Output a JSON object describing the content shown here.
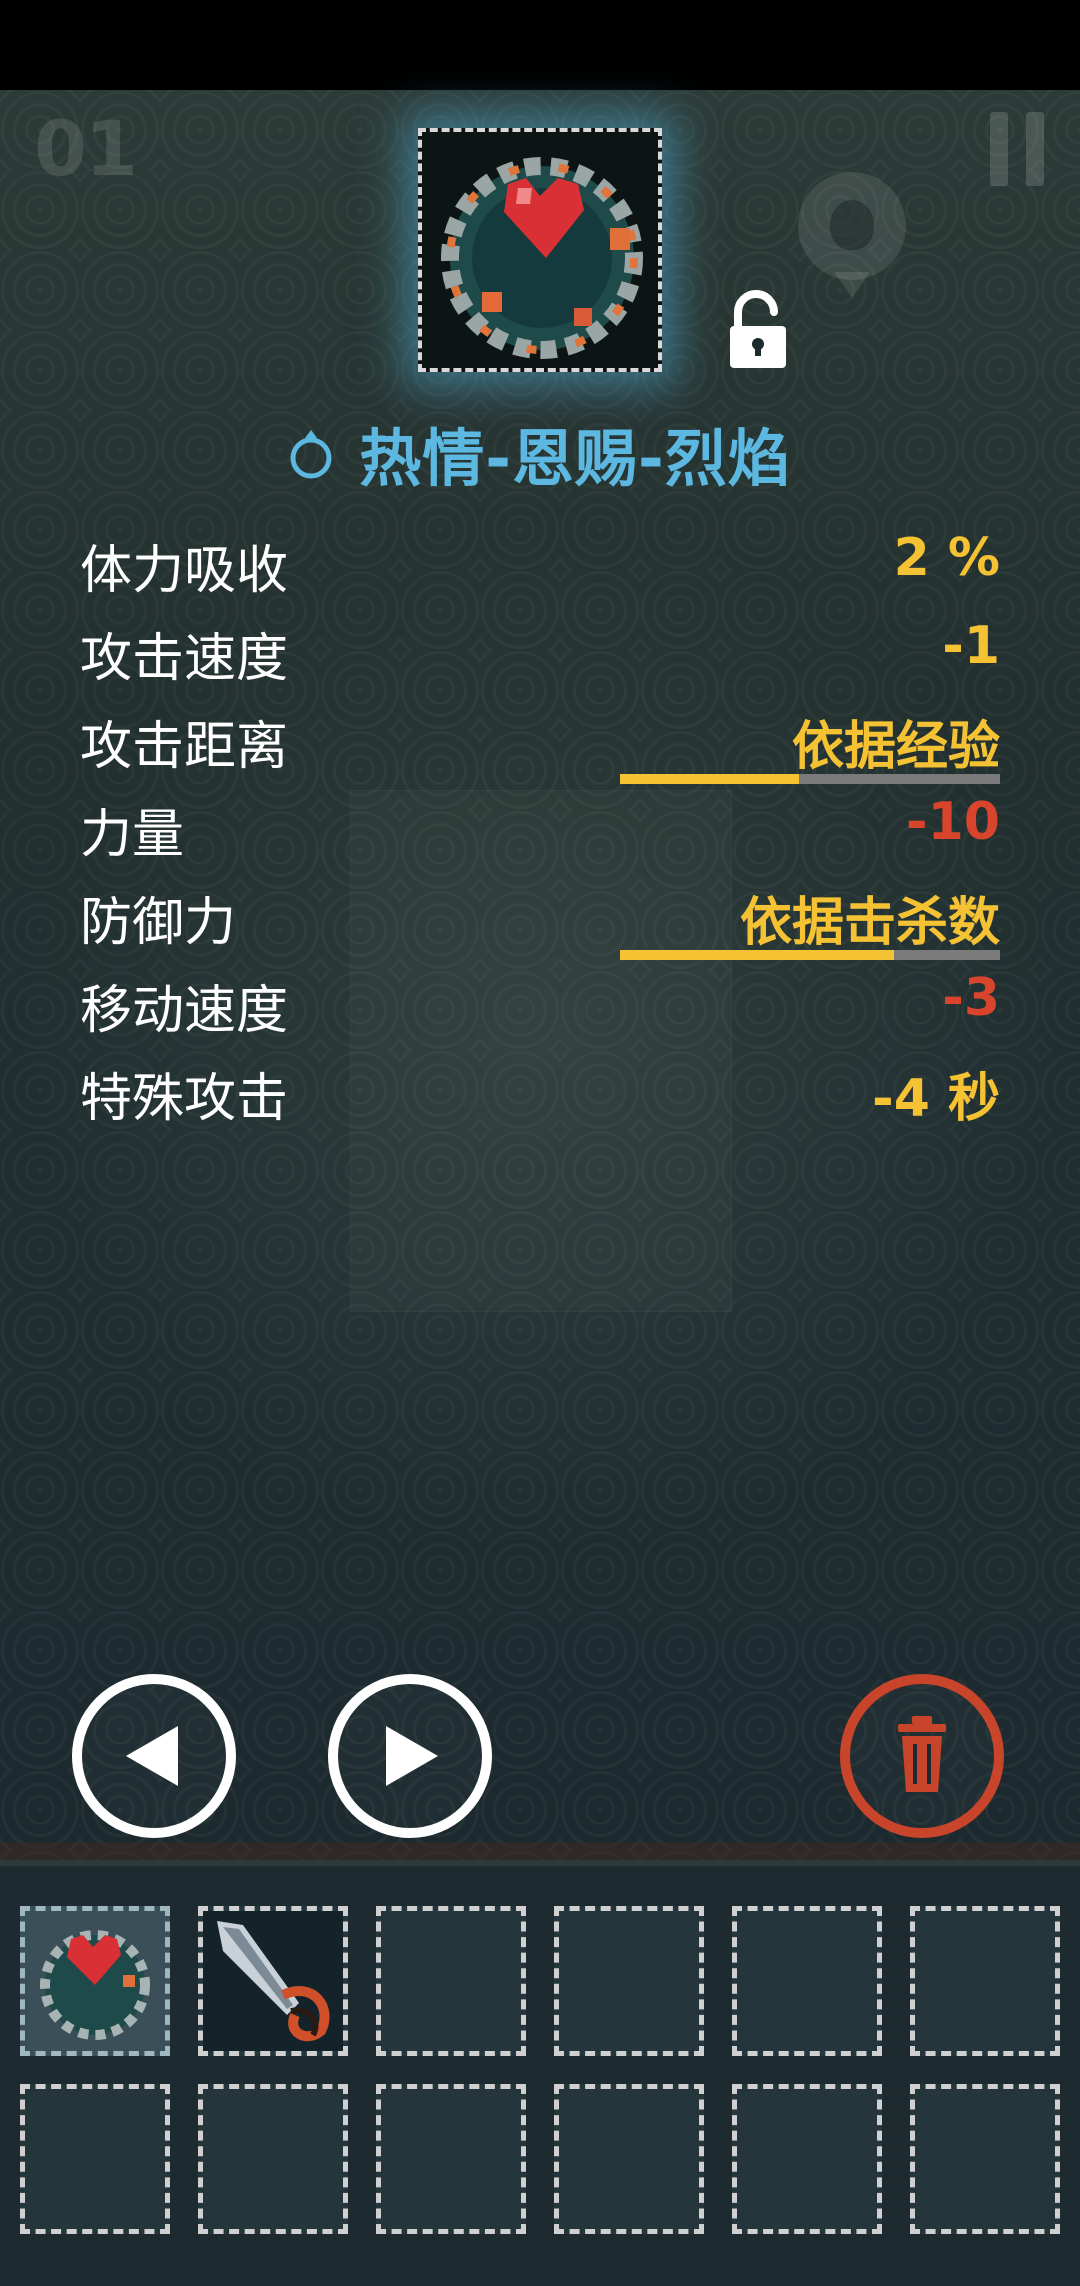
{
  "hud": {
    "wave_count": "01"
  },
  "item": {
    "name": "热情-恩赐-烈焰",
    "type_icon": "ring-icon",
    "image_icon": "heart-amulet-icon",
    "lock_icon": "unlocked-padlock-icon"
  },
  "stats": [
    {
      "label": "体力吸收",
      "value": "2 %",
      "color": "#f5c234"
    },
    {
      "label": "攻击速度",
      "value": "-1",
      "color": "#f5c234"
    },
    {
      "label": "攻击距离",
      "value": "依据经验",
      "color": "#f5c234",
      "progress": 0.47
    },
    {
      "label": "力量",
      "value": "-10",
      "color": "#d8452c"
    },
    {
      "label": "防御力",
      "value": "依据击杀数",
      "color": "#f5c234",
      "progress": 0.72
    },
    {
      "label": "移动速度",
      "value": "-3",
      "color": "#d8452c"
    },
    {
      "label": "特殊攻击",
      "value": "-4 秒",
      "color": "#f5c234"
    }
  ],
  "controls": {
    "prev_icon": "triangle-left-icon",
    "next_icon": "triangle-right-icon",
    "delete_icon": "trash-icon",
    "delete_color": "#c8442a"
  },
  "inventory": {
    "slots": [
      {
        "item": "heart-amulet",
        "selected": true
      },
      {
        "item": "blade-weapon",
        "selected": false
      },
      {
        "item": null
      },
      {
        "item": null
      },
      {
        "item": null
      },
      {
        "item": null
      },
      {
        "item": null
      },
      {
        "item": null
      },
      {
        "item": null
      },
      {
        "item": null
      },
      {
        "item": null
      },
      {
        "item": null
      }
    ]
  },
  "colors": {
    "title_blue": "#5cb8e0",
    "value_yellow": "#f5c234",
    "value_red": "#d8452c",
    "glow": "#50aad2"
  }
}
